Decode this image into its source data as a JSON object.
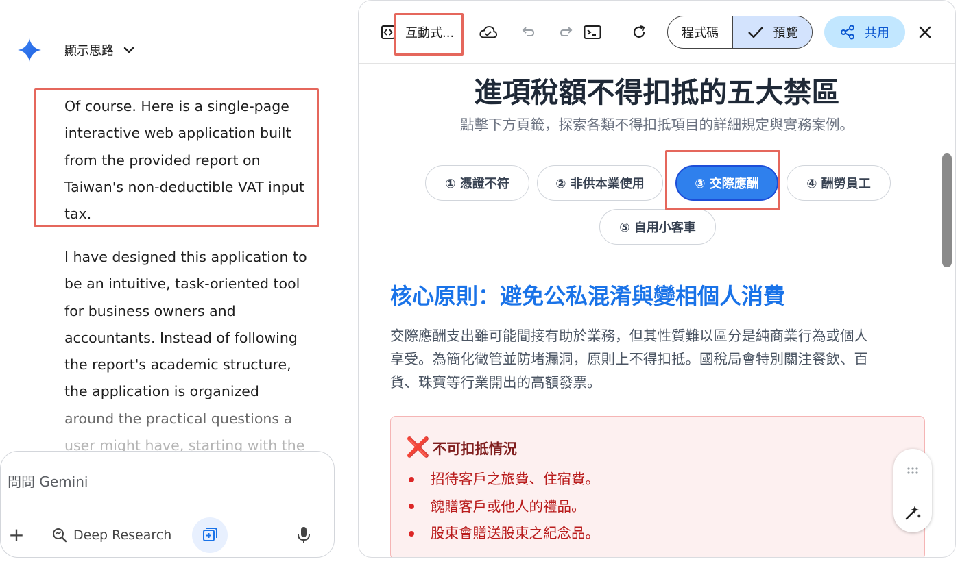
{
  "chat": {
    "thinking_label": "顯示思路",
    "message1": [
      "Of course. Here is a single-page",
      "interactive web application built",
      "from the provided report on",
      "Taiwan's non-deductible VAT input",
      "tax."
    ],
    "message2": [
      "I have designed this application to",
      "be an intuitive, task-oriented tool",
      "for business owners and",
      "accountants. Instead of following",
      "the report's academic structure,",
      "the application is organized",
      "around the practical questions a",
      "user might have, starting with the"
    ]
  },
  "composer": {
    "placeholder": "問問 Gemini",
    "plus": "+",
    "deep_research": "Deep Research"
  },
  "canvas": {
    "title": "互動式...",
    "code_tab": "程式碼",
    "preview_tab": "預覽",
    "share": "共用"
  },
  "app": {
    "title": "進項稅額不得扣抵的五大禁區",
    "subtitle": "點擊下方頁籤，探索各類不得扣抵項目的詳細規定與實務案例。",
    "tabs": [
      {
        "label": "① 憑證不符"
      },
      {
        "label": "② 非供本業使用"
      },
      {
        "label": "③ 交際應酬"
      },
      {
        "label": "④ 酬勞員工"
      },
      {
        "label": "⑤ 自用小客車"
      }
    ],
    "section_title": "核心原則：避免公私混淆與變相個人消費",
    "paragraph": [
      "交際應酬支出雖可能間接有助於業務，但其性質難以區分是純商業行為或個人",
      "享受。為簡化徵管並防堵漏洞，原則上不得扣抵。國稅局會特別關注餐飲、百",
      "貨、珠寶等行業開出的高額發票。"
    ],
    "warning": {
      "icon": "❌",
      "title": "不可扣抵情況",
      "items": [
        "招待客戶之旅費、住宿費。",
        "餽贈客戶或他人的禮品。",
        "股東會贈送股東之紀念品。"
      ]
    }
  },
  "colors": {
    "accent_blue": "#1a73e8",
    "active_tab": "#2f80ed",
    "annotation_red": "#e5675c",
    "warning_red": "#dc2626"
  }
}
